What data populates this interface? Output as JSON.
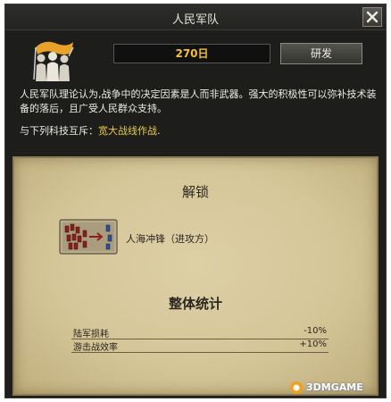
{
  "window": {
    "title": "人民军队",
    "close_icon": "close-x-icon"
  },
  "tech": {
    "icon": "people-army-silhouette-icon",
    "days": "270日",
    "research_label": "研发",
    "description": "人民军队理论认为,战争中的决定因素是人而非武器。强大的积极性可以弥补技术装备的落后，且广受人民群众支持。",
    "exclusive_label": "与下列科技互斥：",
    "exclusive_tech": "宽大战线作战",
    "exclusive_suffix": "."
  },
  "unlock": {
    "heading": "解锁",
    "item_icon": "human-wave-map-icon",
    "item_label": "人海冲锋（进攻方）"
  },
  "stats": {
    "heading": "整体统计",
    "rows": [
      {
        "label": "陆军损耗",
        "value": "-10%"
      },
      {
        "label": "游击战效率",
        "value": "+10%"
      }
    ]
  },
  "watermark": {
    "text": "3DMGAME",
    "icon": "3dm-logo-icon",
    "color": "#f2a01c"
  }
}
